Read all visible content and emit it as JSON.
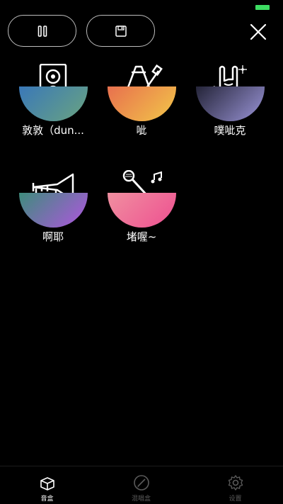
{
  "status_bar": {
    "battery_color": "#3ddc62"
  },
  "toolbar": {
    "pause_icon": "pause-icon",
    "save_icon": "floppy-disk-icon",
    "close_icon": "close-icon"
  },
  "sounds": [
    {
      "label": "敦敦（dun...",
      "icon": "speaker-icon",
      "gradient": [
        "#3a78b8",
        "#6aa480"
      ]
    },
    {
      "label": "呲",
      "icon": "paint-brush-icon",
      "gradient": [
        "#e8704e",
        "#f2c749"
      ]
    },
    {
      "label": "噗呲克",
      "icon": "rock-hand-icon",
      "gradient": [
        "#242438",
        "#9b95d8"
      ]
    },
    {
      "label": "啊耶",
      "icon": "trumpet-icon",
      "gradient": [
        "#3e8c7c",
        "#b155e0"
      ]
    },
    {
      "label": "堵喔~",
      "icon": "microphone-icon",
      "gradient": [
        "#f08fa0",
        "#ee4f90"
      ]
    }
  ],
  "tabbar": {
    "tabs": [
      {
        "label": "音盒",
        "icon": "box-icon",
        "active": true
      },
      {
        "label": "混唱盒",
        "icon": "pen-circle-icon",
        "active": false
      },
      {
        "label": "设置",
        "icon": "gear-icon",
        "active": false
      }
    ],
    "active_color": "#ffffff",
    "inactive_color": "#5a5a5a"
  }
}
